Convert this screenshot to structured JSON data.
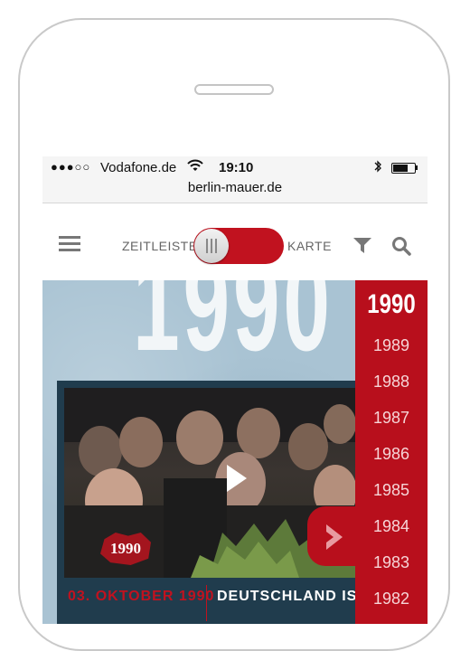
{
  "status_bar": {
    "signal": "●●●○○",
    "carrier": "Vodafone.de",
    "time": "19:10",
    "battery_level": 0.7
  },
  "browser": {
    "url": "berlin-mauer.de"
  },
  "nav": {
    "toggle_left_label": "ZEITLEISTE",
    "toggle_right_label": "KARTE",
    "icons": [
      "menu-icon",
      "filter-icon",
      "search-icon"
    ]
  },
  "hero": {
    "big_year": "1990"
  },
  "video": {
    "badge": "1990",
    "date": "03. OKTOBER 1990",
    "title": "DEUTSCHLAND IST WIEDER"
  },
  "timeline": {
    "current_year": "1990",
    "years": [
      "1989",
      "1988",
      "1987",
      "1986",
      "1985",
      "1984",
      "1983",
      "1982"
    ]
  },
  "colors": {
    "accent": "#c1121f",
    "sidebar": "#b80f1c",
    "background": "#a9c3d2",
    "card": "#203c4d"
  }
}
